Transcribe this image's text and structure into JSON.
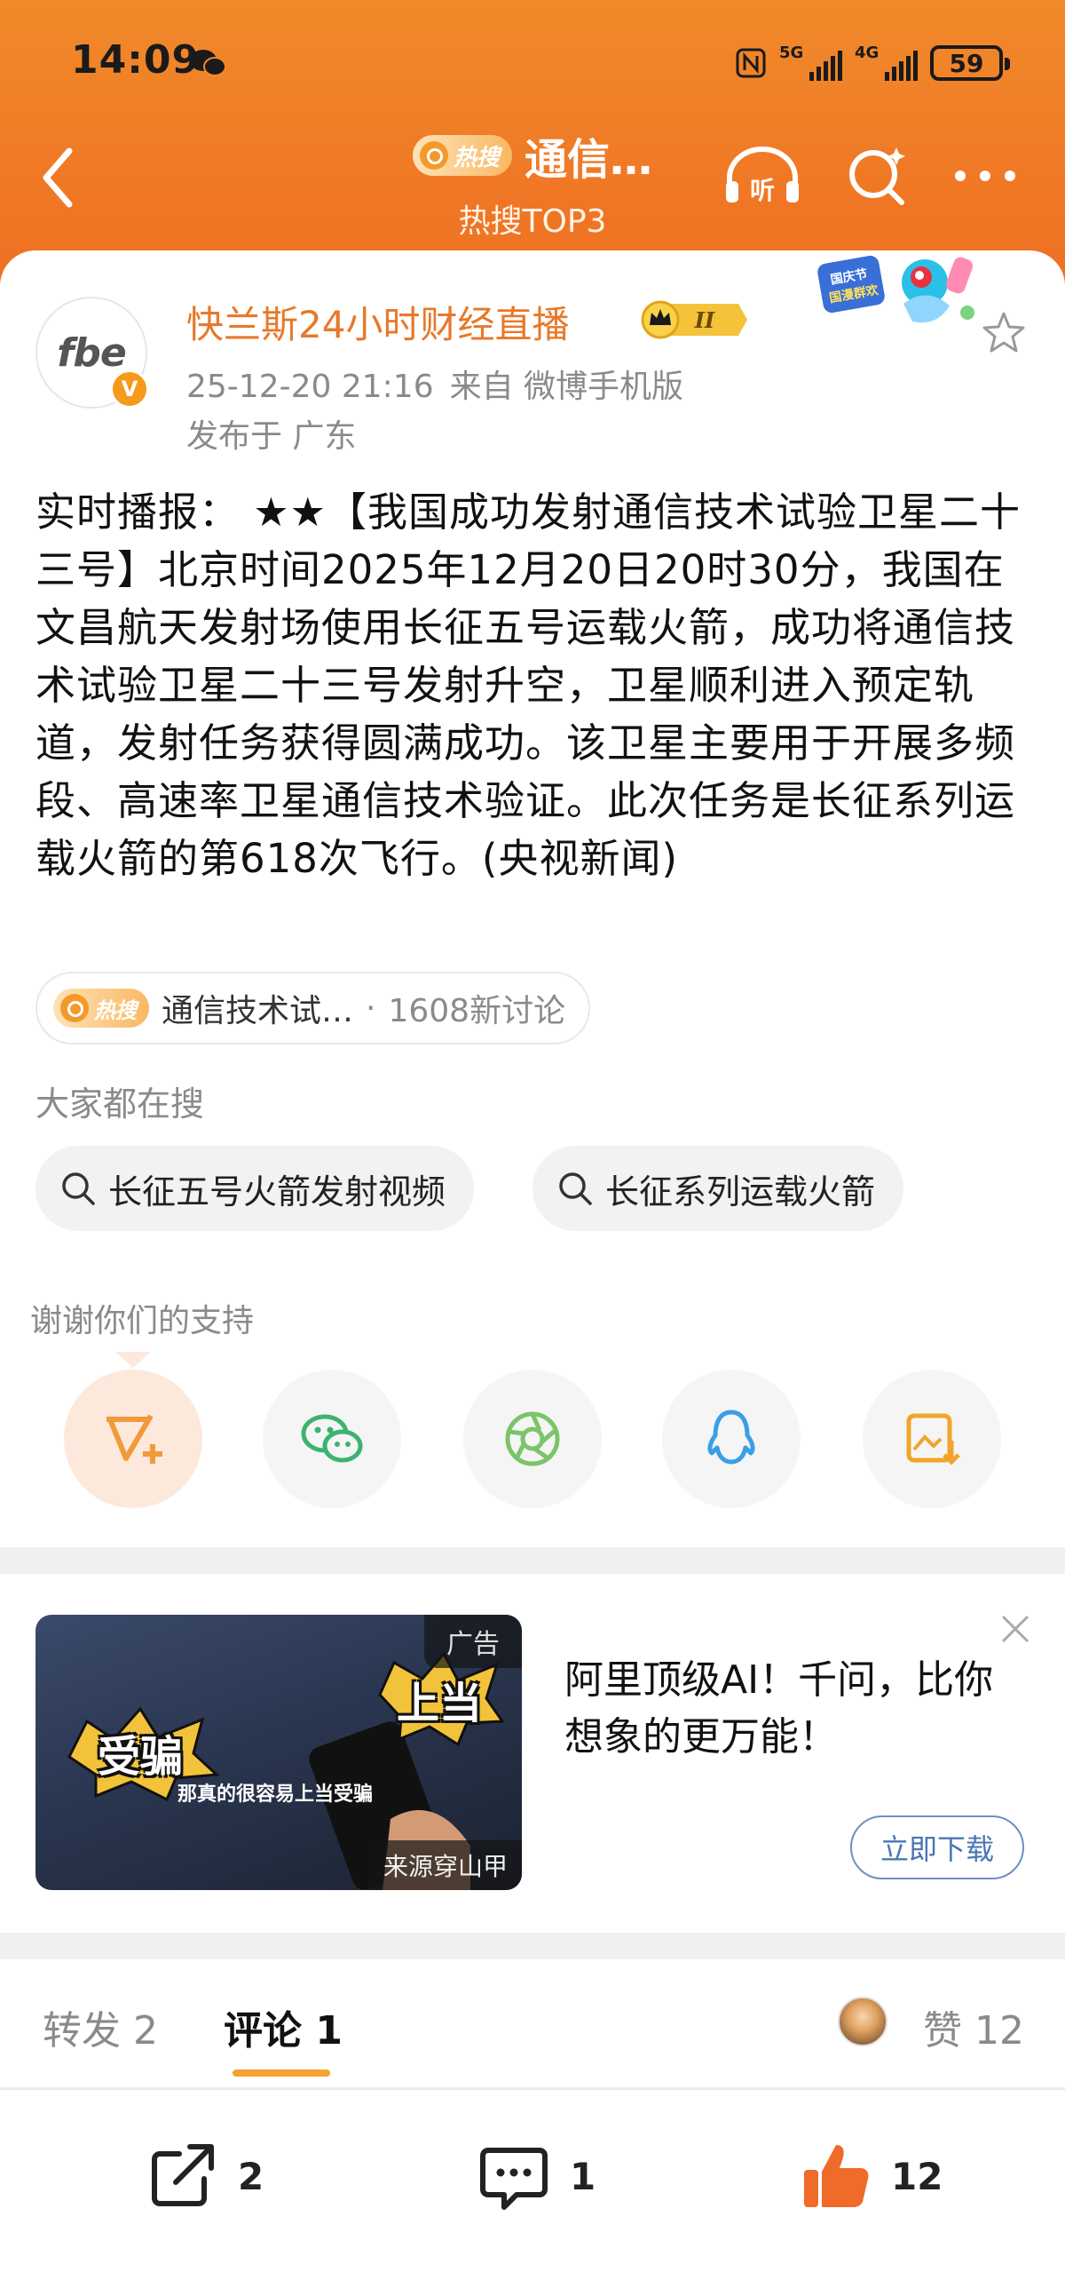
{
  "status_bar": {
    "time": "14:09",
    "net1": "5G",
    "net2": "4G",
    "battery": "59"
  },
  "nav": {
    "hot_badge": "热搜",
    "title": "通信…",
    "subtitle": "热搜TOP3"
  },
  "post": {
    "avatar_text": "fbe",
    "verified_mark": "V",
    "author": "快兰斯24小时财经直播",
    "crown_level": "II",
    "date": "25-12-20 21:16",
    "source": "来自 微博手机版",
    "location": "发布于 广东",
    "body": "实时播报： ★★【我国成功发射通信技术试验卫星二十三号】北京时间2025年12月20日20时30分，我国在文昌航天发射场使用长征五号运载火箭，成功将通信技术试验卫星二十三号发射升空，卫星顺利进入预定轨道，发射任务获得圆满成功。该卫星主要用于开展多频段、高速率卫星通信技术验证。此次任务是长征系列运载火箭的第618次飞行。(央视新闻)",
    "decor_badge": "国庆节 国漫群欢"
  },
  "topic": {
    "badge": "热搜",
    "name": "通信技术试…",
    "separator": "·",
    "count": "1608新讨论"
  },
  "everyone_search": {
    "title": "大家都在搜",
    "items": [
      "长征五号火箭发射视频",
      "长征系列运载火箭"
    ]
  },
  "support": {
    "title": "谢谢你们的支持"
  },
  "ad": {
    "tag": "广告",
    "source": "来源穿山甲",
    "caption": "那真的很容易上当受骗",
    "burst_left": "受骗",
    "burst_right": "上当",
    "text": "阿里顶级AI！千问，比你想象的更万能！",
    "download": "立即下载"
  },
  "tabs": {
    "repost": "转发 2",
    "comment": "评论 1",
    "likes": "赞 12"
  },
  "bottom_bar": {
    "repost_count": "2",
    "comment_count": "1",
    "like_count": "12"
  },
  "colors": {
    "header": "#f07a26",
    "author": "#e8782a",
    "tab_underline": "#f3a233",
    "download": "#4a76b3"
  }
}
